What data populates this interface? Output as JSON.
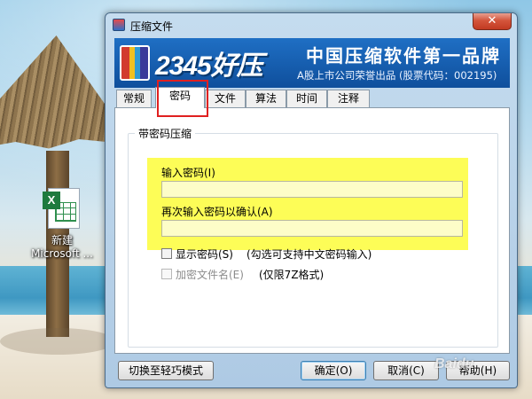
{
  "desktop": {
    "icon_label_line1": "新建",
    "icon_label_line2": "Microsoft ...",
    "icon_name": "excel-file-icon",
    "icon_badge": "X"
  },
  "window": {
    "title": "压缩文件",
    "close_glyph": "✕"
  },
  "banner": {
    "logo": "2345好压",
    "slogan": "中国压缩软件第一品牌",
    "listing": "A股上市公司荣誉出品 (股票代码：002195)"
  },
  "tabs": [
    {
      "label": "常规",
      "active": false
    },
    {
      "label": "密码",
      "active": true
    },
    {
      "label": "文件",
      "active": false
    },
    {
      "label": "算法",
      "active": false
    },
    {
      "label": "时间",
      "active": false
    },
    {
      "label": "注释",
      "active": false
    }
  ],
  "password_group": {
    "title": "带密码压缩",
    "enter_label": "输入密码(I)",
    "enter_value": "",
    "confirm_label": "再次输入密码以确认(A)",
    "confirm_value": "",
    "show_password_label": "显示密码(S)",
    "show_password_hint": "(勾选可支持中文密码输入)",
    "show_password_checked": false,
    "encrypt_names_label": "加密文件名(E)",
    "encrypt_names_hint": "(仅限7Z格式)",
    "encrypt_names_checked": false,
    "encrypt_names_enabled": false
  },
  "buttons": {
    "light_mode": "切换至轻巧模式",
    "ok": "确定(O)",
    "cancel": "取消(C)",
    "help": "帮助(H)"
  },
  "watermark": "Baidu",
  "colors": {
    "banner_blue": "#1f6fc4",
    "highlight_yellow": "#fdfd57",
    "annotation_red": "#e02020"
  }
}
